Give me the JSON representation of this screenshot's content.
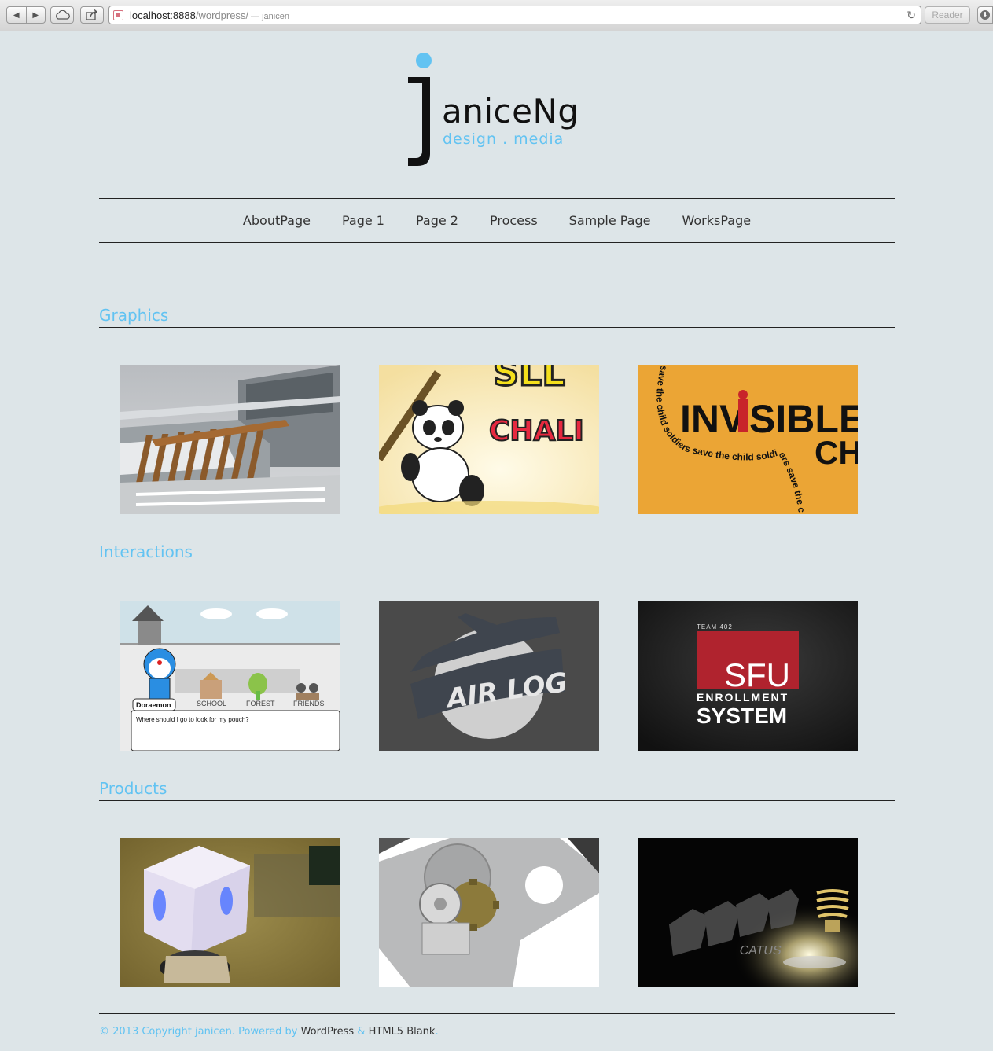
{
  "browser": {
    "url_host": "localhost:8888",
    "url_path": "/wordpress/",
    "page_title": "— janicen",
    "reader_label": "Reader"
  },
  "logo": {
    "initial": "j",
    "name": "aniceNg",
    "tagline": "design . media",
    "accent_color": "#62c3f2"
  },
  "nav": {
    "items": [
      "AboutPage",
      "Page 1",
      "Page 2",
      "Process",
      "Sample Page",
      "WorksPage"
    ]
  },
  "sections": [
    {
      "title": "Graphics"
    },
    {
      "title": "Interactions"
    },
    {
      "title": "Products"
    }
  ],
  "thumbs": {
    "panda_text": "CHALI",
    "invisible_text_1": "INV",
    "invisible_text_2": "SIBLE",
    "invisible_text_3": "CH",
    "invisible_curve": "save the child soldiers save the child soldiers save the child so",
    "doraemon_tab": "Doraemon",
    "doraemon_labels": [
      "SCHOOL",
      "FOREST",
      "FRIENDS"
    ],
    "doraemon_prompt": "Where should I go to look for my pouch?",
    "airlog_text": "AIR LOG",
    "sfu_team": "TEAM 402",
    "sfu_logo": "SFU",
    "sfu_line1": "ENROLLMENT",
    "sfu_line2": "SYSTEM",
    "sculpture_text": "CATUS"
  },
  "footer": {
    "copyright": "© 2013 Copyright janicen. Powered by ",
    "wordpress": "WordPress",
    "amp": " & ",
    "blank": "HTML5 Blank",
    "end": "."
  }
}
